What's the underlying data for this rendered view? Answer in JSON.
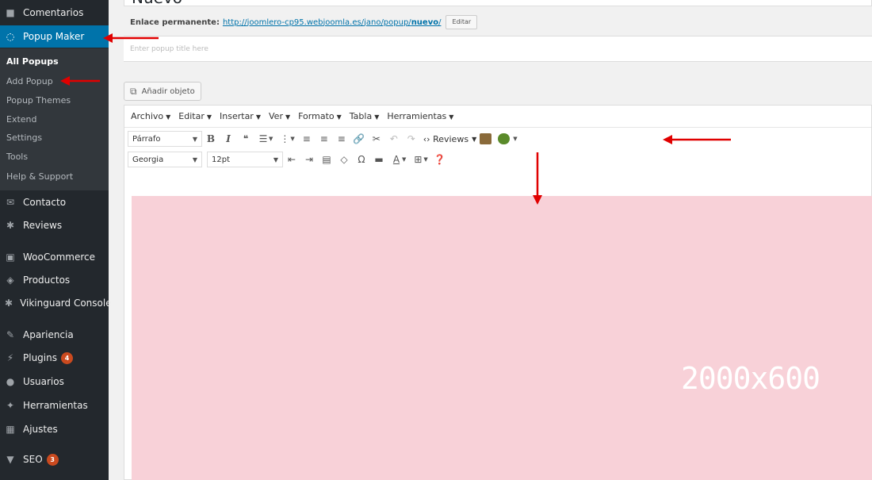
{
  "sidebar": {
    "items": [
      {
        "label": "Comentarios",
        "icon": "comment-icon",
        "glyph": "■"
      },
      {
        "label": "Popup Maker",
        "icon": "popup-maker-icon",
        "glyph": "◌"
      },
      {
        "label": "Contacto",
        "icon": "mail-icon",
        "glyph": "✉"
      },
      {
        "label": "Reviews",
        "icon": "gear-icon",
        "glyph": "✱"
      },
      {
        "label": "WooCommerce",
        "icon": "woocommerce-icon",
        "glyph": "▣"
      },
      {
        "label": "Productos",
        "icon": "archive-icon",
        "glyph": "◈"
      },
      {
        "label": "Vikinguard Console",
        "icon": "gear-icon",
        "glyph": "✱"
      },
      {
        "label": "Apariencia",
        "icon": "paintbrush-icon",
        "glyph": "✎"
      },
      {
        "label": "Plugins",
        "icon": "plugin-icon",
        "glyph": "⚡",
        "badge": "4"
      },
      {
        "label": "Usuarios",
        "icon": "users-icon",
        "glyph": "●"
      },
      {
        "label": "Herramientas",
        "icon": "wrench-icon",
        "glyph": "✦"
      },
      {
        "label": "Ajustes",
        "icon": "settings-icon",
        "glyph": "▦"
      },
      {
        "label": "SEO",
        "icon": "seo-icon",
        "glyph": "▼",
        "badge": "3"
      }
    ],
    "submenu": [
      "All Popups",
      "Add Popup",
      "Popup Themes",
      "Extend",
      "Settings",
      "Tools",
      "Help & Support"
    ]
  },
  "header": {
    "title": "Nuevo",
    "permalink_label": "Enlace permanente:",
    "permalink_url": "http://joomlero-cp95.webjoomla.es/jano/popup/",
    "permalink_slug": "nuevo",
    "permalink_trailing": "/",
    "edit_label": "Editar",
    "title_placeholder": "Enter popup title here"
  },
  "editor": {
    "add_media": "Añadir objeto",
    "menus": [
      "Archivo",
      "Editar",
      "Insertar",
      "Ver",
      "Formato",
      "Tabla",
      "Herramientas"
    ],
    "format_select": "Párrafo",
    "font_select": "Georgia",
    "size_select": "12pt",
    "reviews_label": "Reviews",
    "placeholder_image": "2000x600"
  },
  "colors": {
    "sidebar_bg": "#23282d",
    "active_bg": "#0073aa",
    "badge": "#ca4a1f",
    "placeholder_bg": "#f8d1d8",
    "annotation": "#e00000"
  }
}
